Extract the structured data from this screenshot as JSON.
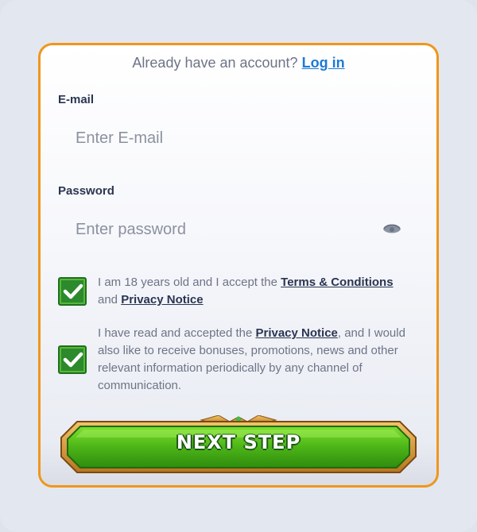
{
  "header": {
    "already_text": "Already have an account?",
    "login_link": "Log in"
  },
  "email": {
    "label": "E-mail",
    "placeholder": "Enter E-mail",
    "value": ""
  },
  "password": {
    "label": "Password",
    "placeholder": "Enter password",
    "value": "",
    "toggle_icon": "eye-icon"
  },
  "consent_age": {
    "checked": true,
    "text_before": "I am 18 years old and I accept the ",
    "terms_link": "Terms & Conditions",
    "text_mid": " and ",
    "privacy_link": "Privacy Notice"
  },
  "consent_marketing": {
    "checked": true,
    "text_before": "I have read and accepted the ",
    "privacy_link": "Privacy Notice",
    "text_after": ", and I would also like to receive bonuses, promotions, news and other relevant information periodically by any channel of communication."
  },
  "next_button": {
    "label": "NEXT STEP"
  },
  "colors": {
    "accent_border": "#f0961c",
    "link_blue": "#1d7ad6",
    "button_green": "#4cb517",
    "checkbox_green": "#2c8a2c"
  }
}
